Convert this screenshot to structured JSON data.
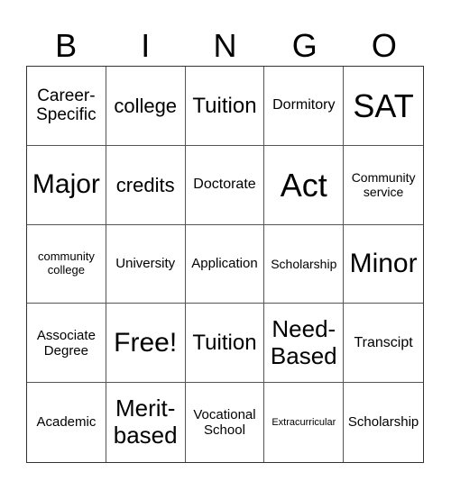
{
  "header": [
    "B",
    "I",
    "N",
    "G",
    "O"
  ],
  "cells": [
    {
      "text": "Career-\nSpecific",
      "size": 19
    },
    {
      "text": "college",
      "size": 22
    },
    {
      "text": "Tuition",
      "size": 24
    },
    {
      "text": "Dormitory",
      "size": 16
    },
    {
      "text": "SAT",
      "size": 36
    },
    {
      "text": "Major",
      "size": 30
    },
    {
      "text": "credits",
      "size": 22
    },
    {
      "text": "Doctorate",
      "size": 16
    },
    {
      "text": "Act",
      "size": 36
    },
    {
      "text": "Community\nservice",
      "size": 14
    },
    {
      "text": "community\ncollege",
      "size": 13
    },
    {
      "text": "University",
      "size": 15
    },
    {
      "text": "Application",
      "size": 15
    },
    {
      "text": "Scholarship",
      "size": 14
    },
    {
      "text": "Minor",
      "size": 30
    },
    {
      "text": "Associate\nDegree",
      "size": 15
    },
    {
      "text": "Free!",
      "size": 30
    },
    {
      "text": "Tuition",
      "size": 24
    },
    {
      "text": "Need-\nBased",
      "size": 26
    },
    {
      "text": "Transcipt",
      "size": 16
    },
    {
      "text": "Academic",
      "size": 15
    },
    {
      "text": "Merit-\nbased",
      "size": 26
    },
    {
      "text": "Vocational\nSchool",
      "size": 15
    },
    {
      "text": "Extracurricular",
      "size": 11
    },
    {
      "text": "Scholarship",
      "size": 15
    }
  ]
}
